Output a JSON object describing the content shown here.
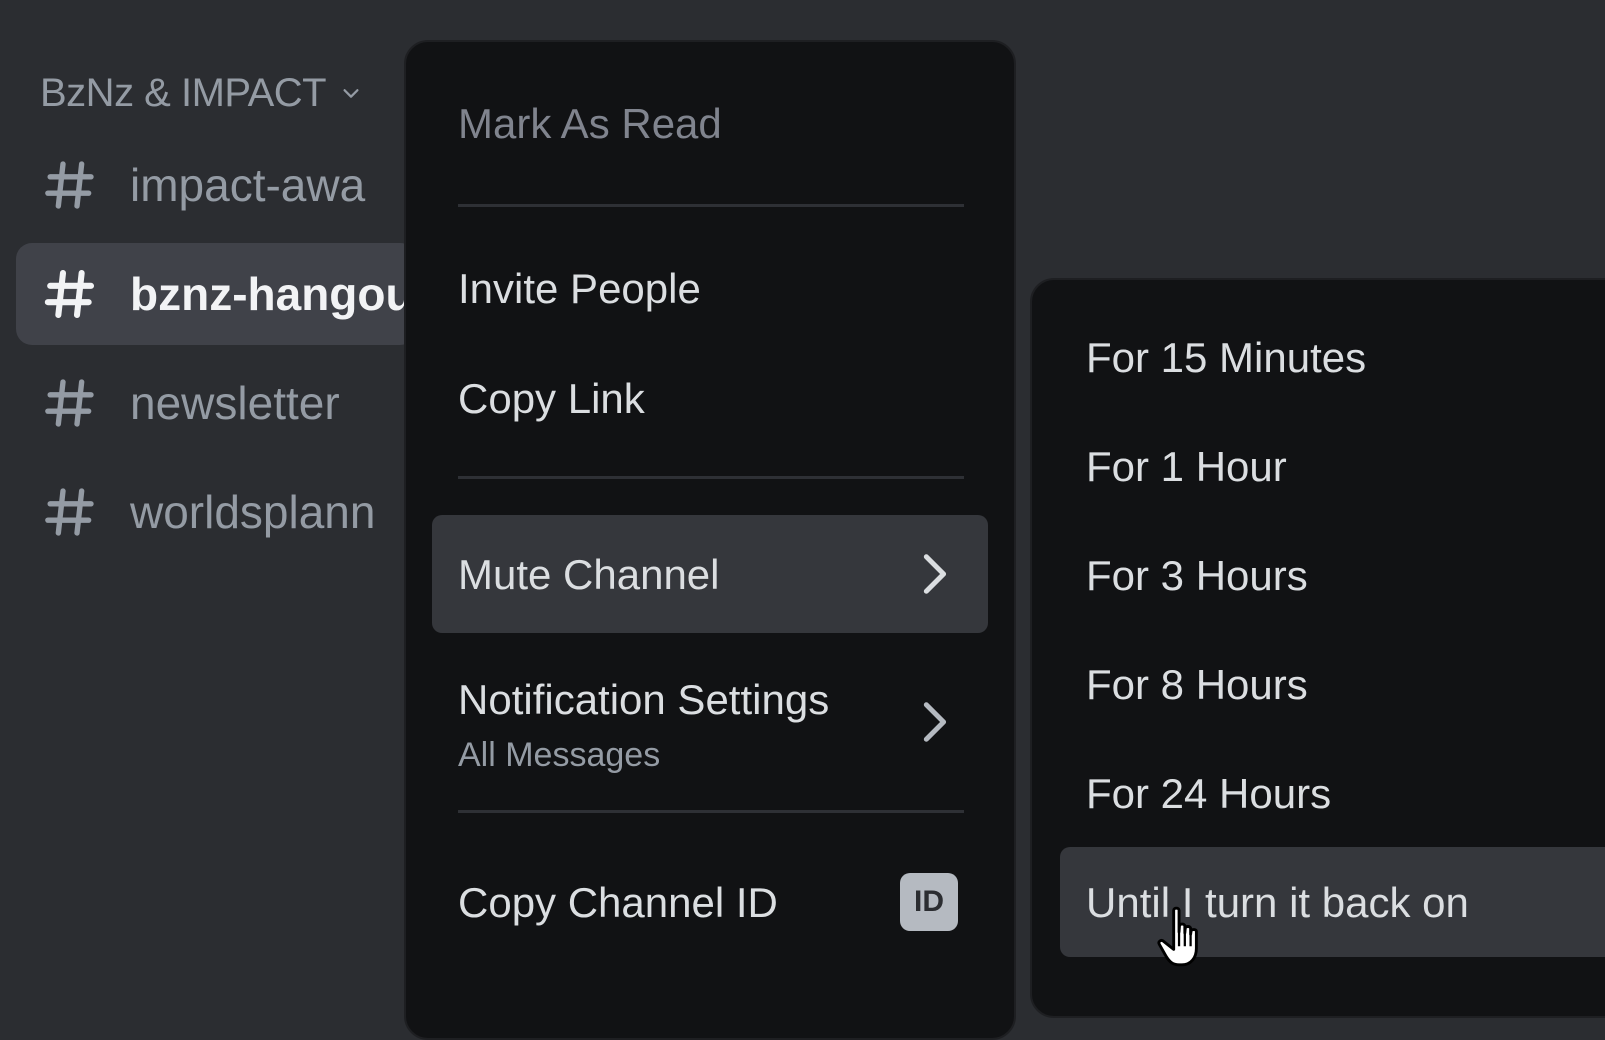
{
  "sidebar": {
    "category": {
      "name": "BzNz & IMPACT",
      "icon": "chevron-down-icon"
    },
    "channels": [
      {
        "name": "impact-awa",
        "icon": "hash-icon",
        "active": false
      },
      {
        "name": "bznz-hangou",
        "icon": "hash-icon",
        "active": true
      },
      {
        "name": "newsletter",
        "icon": "hash-icon",
        "active": false
      },
      {
        "name": "worldsplann",
        "icon": "hash-icon",
        "active": false
      }
    ]
  },
  "context_menu": {
    "mark_as_read": "Mark As Read",
    "invite_people": "Invite People",
    "copy_link": "Copy Link",
    "mute_channel": "Mute Channel",
    "notification_settings": "Notification Settings",
    "notification_settings_value": "All Messages",
    "copy_channel_id": "Copy Channel ID",
    "id_badge": "ID"
  },
  "mute_submenu": {
    "items": [
      "For 15 Minutes",
      "For 1 Hour",
      "For 3 Hours",
      "For 8 Hours",
      "For 24 Hours",
      "Until I turn it back on"
    ]
  },
  "colors": {
    "background": "#2b2d31",
    "menu_background": "#111214",
    "highlight": "#35373c",
    "text": "#dbdee1",
    "muted_text": "#949ba4"
  }
}
